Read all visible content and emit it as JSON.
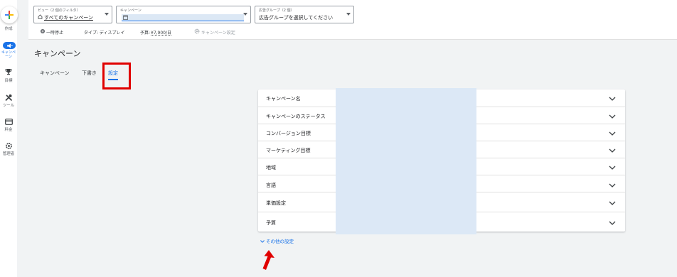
{
  "rail": {
    "create_label": "作成",
    "items": [
      {
        "label": "キャンペーン",
        "icon": "campaign-icon"
      },
      {
        "label": "目標",
        "icon": "trophy-icon"
      },
      {
        "label": "ツール",
        "icon": "tools-icon"
      },
      {
        "label": "料金",
        "icon": "billing-icon"
      },
      {
        "label": "管理者",
        "icon": "admin-gear-icon"
      }
    ]
  },
  "header": {
    "view_selector": {
      "small": "ビュー（2 個のフィルタ）",
      "value": "すべてのキャンペーン"
    },
    "campaign_selector": {
      "small": "キャンペーン"
    },
    "adgroup_selector": {
      "small": "広告グループ（2 個）",
      "value": "広告グループを選択してください"
    },
    "status": "一時停止",
    "type": "タイプ: ディスプレイ",
    "budget_label": "予算:",
    "budget_value": "¥7,900/日",
    "campaign_settings": "キャンペーン設定"
  },
  "page": {
    "title": "キャンペーン",
    "tabs": [
      "キャンペーン",
      "下書き",
      "設定"
    ],
    "active_tab": "設定"
  },
  "settings": {
    "rows": [
      "キャンペーン名",
      "キャンペーンのステータス",
      "コンバージョン目標",
      "マーケティング目標",
      "地域",
      "言語",
      "単価設定",
      "予算"
    ],
    "more_link": "その他の設定"
  },
  "colors": {
    "accent": "#1a73e8",
    "annotation": "#e00000",
    "redaction": "#dce8f6"
  }
}
